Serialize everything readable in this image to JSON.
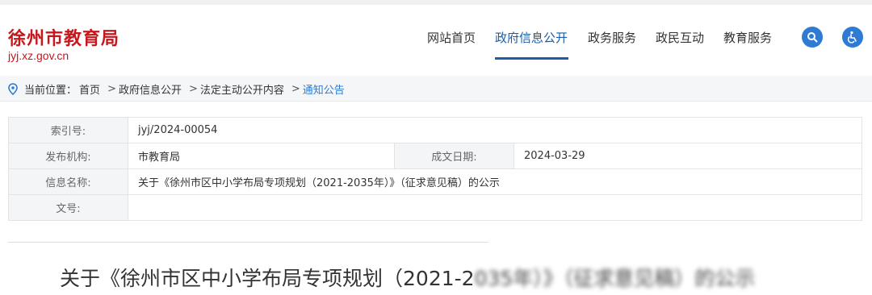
{
  "site": {
    "title": "徐州市教育局",
    "url": "jyj.xz.gov.cn"
  },
  "nav": {
    "items": [
      "网站首页",
      "政府信息公开",
      "政务服务",
      "政民互动",
      "教育服务"
    ],
    "active_index": 1,
    "icons": [
      "search-icon",
      "accessibility-icon"
    ],
    "accent_color": "#1b5ea8"
  },
  "breadcrumb": {
    "label": "当前位置：",
    "items": [
      "首页",
      "政府信息公开",
      "法定主动公开内容",
      "通知公告"
    ],
    "separator": ">"
  },
  "info_table": {
    "index_label": "索引号:",
    "index_value": "jyj/2024-00054",
    "publisher_label": "发布机构:",
    "publisher_value": "市教育局",
    "date_label": "成文日期:",
    "date_value": "2024-03-29",
    "name_label": "信息名称:",
    "name_value": "关于《徐州市区中小学布局专项规划（2021-2035年）》（征求意见稿）的公示",
    "docno_label": "文号:",
    "docno_value": ""
  },
  "document": {
    "title_visible": "关于《徐州市区中小学布局专项规划（2021-2",
    "title_blurred": "035年）》（征求意见稿）的公示"
  }
}
